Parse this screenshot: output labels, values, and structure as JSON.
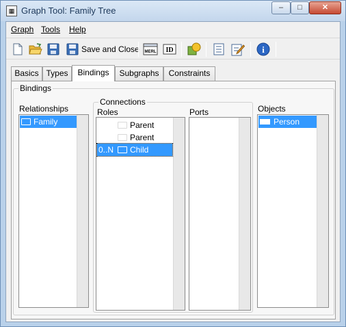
{
  "window": {
    "title": "Graph Tool: Family Tree",
    "title_icon": "app-icon",
    "buttons": {
      "minimize": "–",
      "maximize": "□",
      "close": "✕"
    }
  },
  "menu": [
    {
      "label": "Graph",
      "mnemonic": "G"
    },
    {
      "label": "Tools",
      "mnemonic": "T"
    },
    {
      "label": "Help",
      "mnemonic": "H"
    }
  ],
  "toolbar": {
    "save_close_label": "Save and Close",
    "icons": [
      "new-icon",
      "open-icon",
      "save-icon",
      "save-and-close-icon",
      "merl-icon",
      "id-icon",
      "shapes-icon",
      "properties-icon",
      "edit-icon",
      "info-icon"
    ],
    "merl_text": "MERL",
    "id_text": "ID",
    "info_text": "i"
  },
  "tabs": [
    {
      "label": "Basics",
      "active": false
    },
    {
      "label": "Types",
      "active": false
    },
    {
      "label": "Bindings",
      "active": true
    },
    {
      "label": "Subgraphs",
      "active": false
    },
    {
      "label": "Constraints",
      "active": false
    }
  ],
  "bindings": {
    "group_title": "Bindings",
    "relationships": {
      "label": "Relationships",
      "items": [
        {
          "text": "Family",
          "selected": true
        }
      ]
    },
    "connections": {
      "group_title": "Connections",
      "roles": {
        "label": "Roles",
        "items": [
          {
            "prefix": "",
            "text": "Parent",
            "selected": false
          },
          {
            "prefix": "",
            "text": "Parent",
            "selected": false
          },
          {
            "prefix": "0..N",
            "text": "Child",
            "selected": true
          }
        ]
      },
      "ports": {
        "label": "Ports",
        "items": []
      }
    },
    "objects": {
      "label": "Objects",
      "items": [
        {
          "text": "Person",
          "selected": true
        }
      ]
    }
  },
  "colors": {
    "selection": "#3399ff",
    "title_bar": "#c3d6ec",
    "close_button": "#c64a33"
  }
}
